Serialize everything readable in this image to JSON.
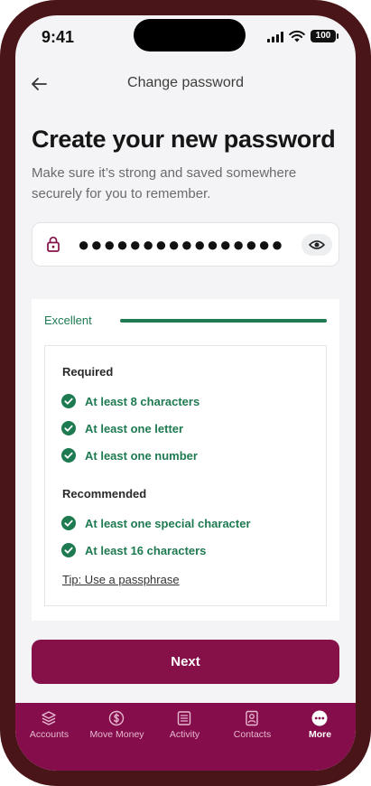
{
  "status_bar": {
    "time": "9:41",
    "battery": "100"
  },
  "header": {
    "title": "Change password"
  },
  "page": {
    "heading": "Create your new password",
    "subtitle": "Make sure it’s strong and saved somewhere securely for you to remember."
  },
  "password": {
    "masked_value": "●●●●●●●●●●●●●●●●",
    "visibility_icon": "eye-icon",
    "lock_icon": "lock-icon"
  },
  "strength": {
    "label": "Excellent",
    "level_fraction": 1.0,
    "color": "#1e7a50"
  },
  "requirements": {
    "required_title": "Required",
    "required": [
      {
        "label": "At least 8 characters",
        "met": true
      },
      {
        "label": "At least one letter",
        "met": true
      },
      {
        "label": "At least one number",
        "met": true
      }
    ],
    "recommended_title": "Recommended",
    "recommended": [
      {
        "label": "At least one special character",
        "met": true
      },
      {
        "label": "At least 16 characters",
        "met": true
      }
    ],
    "tip": "Tip: Use a passphrase"
  },
  "next_label": "Next",
  "tabs": [
    {
      "label": "Accounts",
      "icon": "layers-icon",
      "active": false
    },
    {
      "label": "Move Money",
      "icon": "dollar-circle-icon",
      "active": false
    },
    {
      "label": "Activity",
      "icon": "list-icon",
      "active": false
    },
    {
      "label": "Contacts",
      "icon": "contact-card-icon",
      "active": false
    },
    {
      "label": "More",
      "icon": "more-dots-icon",
      "active": true
    }
  ],
  "colors": {
    "brand": "#861048",
    "tab_bar": "#850d4c",
    "device_frame": "#4a1519",
    "success": "#1e7a50"
  }
}
